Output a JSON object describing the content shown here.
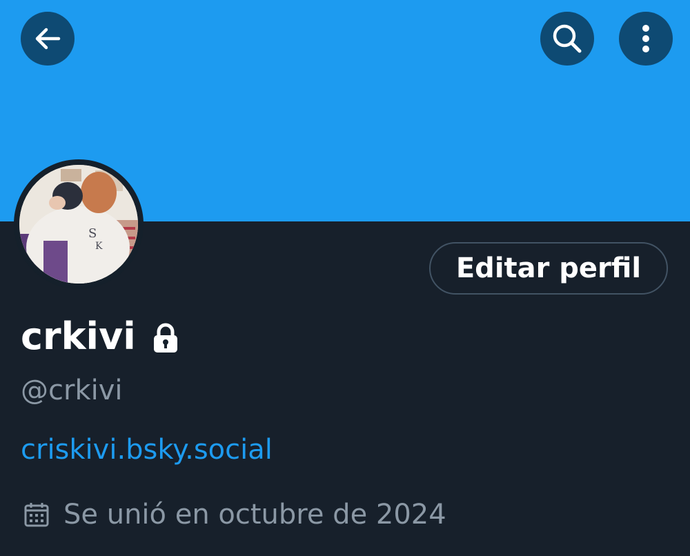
{
  "colors": {
    "banner": "#1d9bf0",
    "background": "#15202b",
    "button_bg": "#0e4a73",
    "text_primary": "#ffffff",
    "text_secondary": "#8b98a5",
    "link": "#1d9bf0",
    "outline": "#425364"
  },
  "header": {
    "back_icon": "arrow-left-icon",
    "search_icon": "search-icon",
    "more_icon": "vertical-dots-icon"
  },
  "profile": {
    "avatar": "profile-photo",
    "edit_button_label": "Editar perfil",
    "display_name": "crkivi",
    "locked_icon": "lock-icon",
    "handle": "@crkivi",
    "website": "criskivi.bsky.social",
    "joined_icon": "calendar-icon",
    "joined_text": "Se unió en octubre de 2024"
  }
}
